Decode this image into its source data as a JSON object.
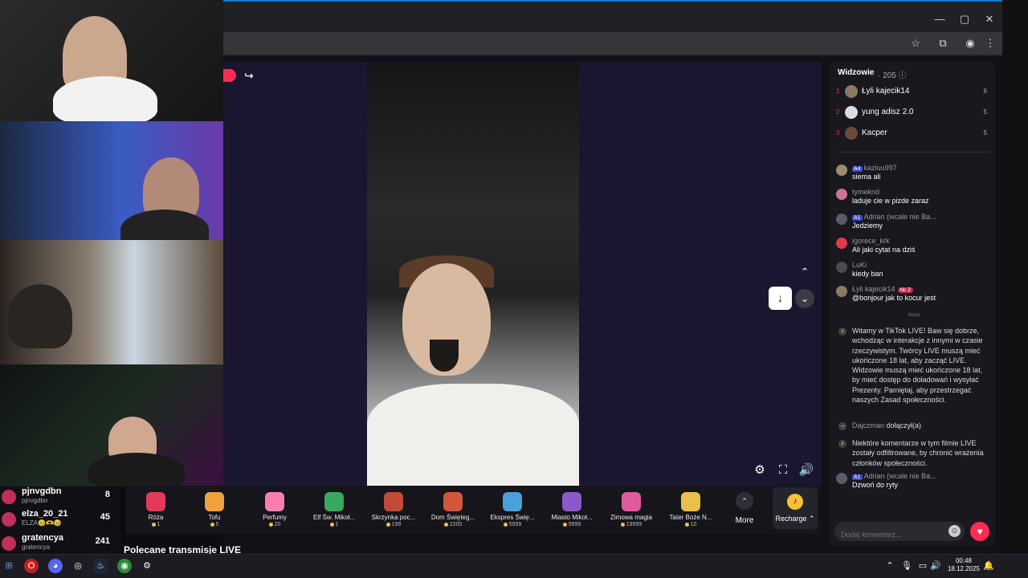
{
  "browser": {
    "window_controls": {
      "minimize": "—",
      "maximize": "▢",
      "close": "✕"
    },
    "toolbar_icons": [
      "star-icon",
      "extensions-icon",
      "profile-icon",
      "menu-icon"
    ]
  },
  "player": {
    "share_icon": "↪",
    "download_icon": "↓",
    "next_icon": "⌄",
    "prev_icon": "⌃",
    "settings_icon": "⚙",
    "fullscreen_icon": "⛶",
    "volume_icon": "🔊"
  },
  "gifts": [
    {
      "name": "Róża",
      "price": "1",
      "color": "#e23a5c"
    },
    {
      "name": "Tofu",
      "price": "5",
      "color": "#f0a23a"
    },
    {
      "name": "Perfumy",
      "price": "20",
      "color": "#f47fb0"
    },
    {
      "name": "Elf Św. Mikoł...",
      "price": "1",
      "color": "#3aa860"
    },
    {
      "name": "Skrzynka poc...",
      "price": "199",
      "color": "#c24a3a"
    },
    {
      "name": "Dom Święteg...",
      "price": "2200",
      "color": "#d2563a"
    },
    {
      "name": "Ekspres Świę...",
      "price": "5999",
      "color": "#4aa0d8"
    },
    {
      "name": "Miasto Mikoł...",
      "price": "9999",
      "color": "#8a5ac8"
    },
    {
      "name": "Zimowa magia",
      "price": "19999",
      "color": "#e05aa0"
    },
    {
      "name": "Tater Boże N...",
      "price": "10",
      "color": "#e8c04a"
    }
  ],
  "more_label": "More",
  "recharge_label": "Recharge ⌃",
  "recommended_label": "Polecane transmisje LIVE",
  "leaderboard": [
    {
      "name": "pjnvgdbn",
      "sub": "pjnvgdbn",
      "score": "8"
    },
    {
      "name": "elza_20_21",
      "sub": "ELZA🥹🫶🥹",
      "score": "45"
    },
    {
      "name": "gratencya",
      "sub": "gratencya",
      "score": "241"
    }
  ],
  "chat": {
    "viewers_label": "Widzowie",
    "viewers_count": "· 205 ⓘ",
    "top_viewers": [
      {
        "rank": "1",
        "name": "Łyli kajecik14",
        "score": "6"
      },
      {
        "rank": "2",
        "name": "yung adisz 2.0",
        "score": "5"
      },
      {
        "rank": "3",
        "name": "Kacper",
        "score": "5"
      }
    ],
    "messages": [
      {
        "badge": "A4",
        "user": "kaziuu997",
        "text": "siema ali"
      },
      {
        "badge": "",
        "user": "tymeknd",
        "text": "laduje cie w pizde zaraz"
      },
      {
        "badge": "A1",
        "user": "Adrian (wcale nie Ba...",
        "text": "Jedziemy"
      },
      {
        "badge": "",
        "user": "igorece_krk",
        "text": "Ali jaki cytat na dziś"
      },
      {
        "badge": "",
        "user": "LuKi",
        "text": "kiedy ban"
      },
      {
        "badge": "",
        "user": "Łyli kajecik14",
        "badge2": "№ 2",
        "text": "@bonjour jak to kocur jest"
      }
    ],
    "new_label": "Nowy",
    "system_welcome": "Witamy w TikTok LIVE! Baw się dobrze, wchodząc w interakcje z innymi w czasie rzeczywistym. Twórcy LIVE muszą mieć ukończone 18 lat, aby zacząć LIVE. Widzowie muszą mieć ukończone 18 lat, by mieć dostęp do doładowań i wysyłać Prezenty. Pamiętaj, aby przestrzegać naszych Zasad społeczności.",
    "join_user": "Dajczman",
    "join_text": "dołączył(a)",
    "system_filter": "Niektóre komentarze w tym filmie LIVE zostały odfiltrowane, by chronić wrażenia członków społeczności.",
    "last_msg": {
      "badge": "A1",
      "user": "Adrian (wcale nie Ba...",
      "text": "Dzwoń do ryty"
    },
    "comment_placeholder": "Dodaj komentarz...",
    "emoji_icon": "☺",
    "heart_icon": "♥"
  },
  "taskbar": {
    "time": "00:48",
    "date": "18.12.2025"
  }
}
